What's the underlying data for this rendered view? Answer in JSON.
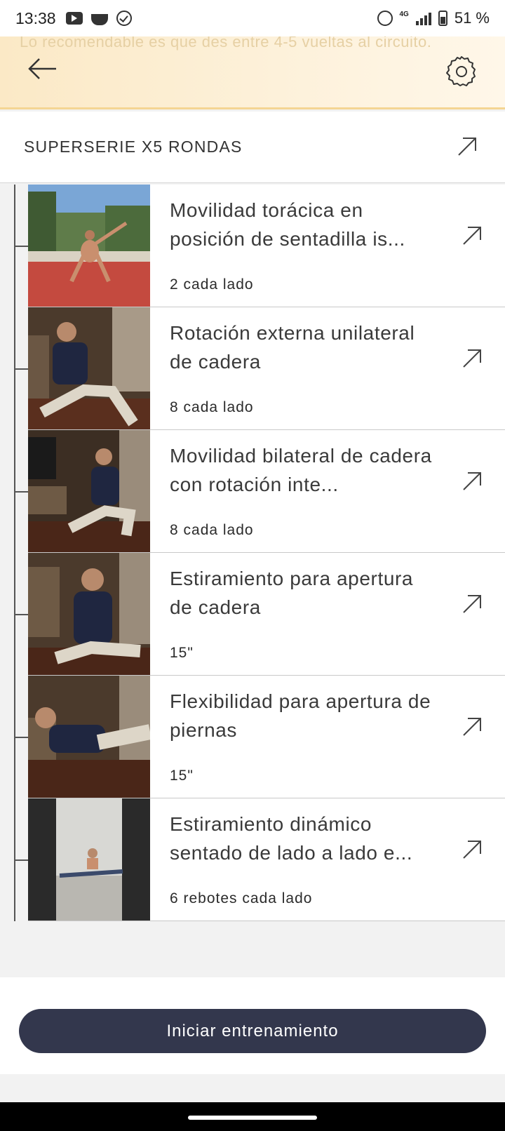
{
  "status_bar": {
    "time": "13:38",
    "network": "4G",
    "battery": "51 %"
  },
  "header": {
    "faded_text": "Lo recomendable es que des entre 4-5 vueltas al circuito.",
    "back_icon": "arrow-left-icon",
    "settings_icon": "gear-icon"
  },
  "section": {
    "title": "SUPERSERIE X5 RONDAS",
    "arrow_icon": "arrow-up-right-icon"
  },
  "exercises": [
    {
      "name": "Movilidad torácica en posición de sentadilla is...",
      "reps": "2 cada lado"
    },
    {
      "name": "Rotación externa unilateral de cadera",
      "reps": "8 cada lado"
    },
    {
      "name": "Movilidad bilateral de cadera con rotación inte...",
      "reps": "8 cada lado"
    },
    {
      "name": "Estiramiento para apertura de cadera",
      "reps": "15\""
    },
    {
      "name": "Flexibilidad para apertura de piernas",
      "reps": "15\""
    },
    {
      "name": "Estiramiento dinámico sentado de lado a lado e...",
      "reps": "6 rebotes cada lado"
    }
  ],
  "start_button": {
    "label": "Iniciar entrenamiento"
  },
  "colors": {
    "header_gradient_start": "#fbe9c6",
    "button_bg": "#33374d",
    "accent_line": "#f4d593"
  }
}
